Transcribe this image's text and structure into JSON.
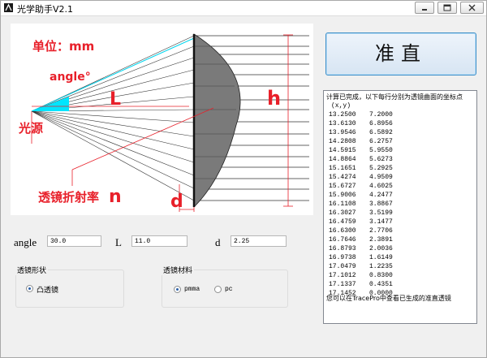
{
  "window": {
    "title": "光学助手V2.1"
  },
  "titlebar_buttons": [
    "minimize-icon",
    "maximize-icon",
    "close-icon"
  ],
  "diagram": {
    "unit_label": "单位：mm",
    "angle_label": "angle°",
    "L_label": "L",
    "h_label": "h",
    "source_label": "光源",
    "index_label": "透镜折射率",
    "n_label": "n",
    "d_label": "d",
    "colors": {
      "annotation": "#e8202a",
      "cone": "#00e5ff",
      "lens": "#777777"
    }
  },
  "collimate_button": {
    "label": "准直"
  },
  "output": {
    "header": "计算已完成，以下每行分别为透镜曲面的坐标点",
    "columns": "(x,y)",
    "rows": [
      [
        "13.2500",
        "7.2000"
      ],
      [
        "13.6130",
        "6.8956"
      ],
      [
        "13.9546",
        "6.5892"
      ],
      [
        "14.2808",
        "6.2757"
      ],
      [
        "14.5915",
        "5.9550"
      ],
      [
        "14.8864",
        "5.6273"
      ],
      [
        "15.1651",
        "5.2925"
      ],
      [
        "15.4274",
        "4.9509"
      ],
      [
        "15.6727",
        "4.6025"
      ],
      [
        "15.9006",
        "4.2477"
      ],
      [
        "16.1108",
        "3.8867"
      ],
      [
        "16.3027",
        "3.5199"
      ],
      [
        "16.4759",
        "3.1477"
      ],
      [
        "16.6300",
        "2.7706"
      ],
      [
        "16.7646",
        "2.3891"
      ],
      [
        "16.8793",
        "2.0036"
      ],
      [
        "16.9738",
        "1.6149"
      ],
      [
        "17.0479",
        "1.2235"
      ],
      [
        "17.1012",
        "0.8300"
      ],
      [
        "17.1337",
        "0.4351"
      ],
      [
        "17.1452",
        "0.0000"
      ]
    ],
    "footer": "您可以在TracePro中查看已生成的准直透镜"
  },
  "params": {
    "angle": {
      "label": "angle",
      "value": "30.0"
    },
    "L": {
      "label": "L",
      "value": "11.0"
    },
    "d": {
      "label": "d",
      "value": "2.25"
    }
  },
  "lens_shape": {
    "title": "透镜形状",
    "options": [
      {
        "label": "凸透镜",
        "checked": true
      }
    ]
  },
  "lens_material": {
    "title": "透镜材料",
    "options": [
      {
        "label": "pmma",
        "checked": true
      },
      {
        "label": "pc",
        "checked": false
      }
    ]
  }
}
